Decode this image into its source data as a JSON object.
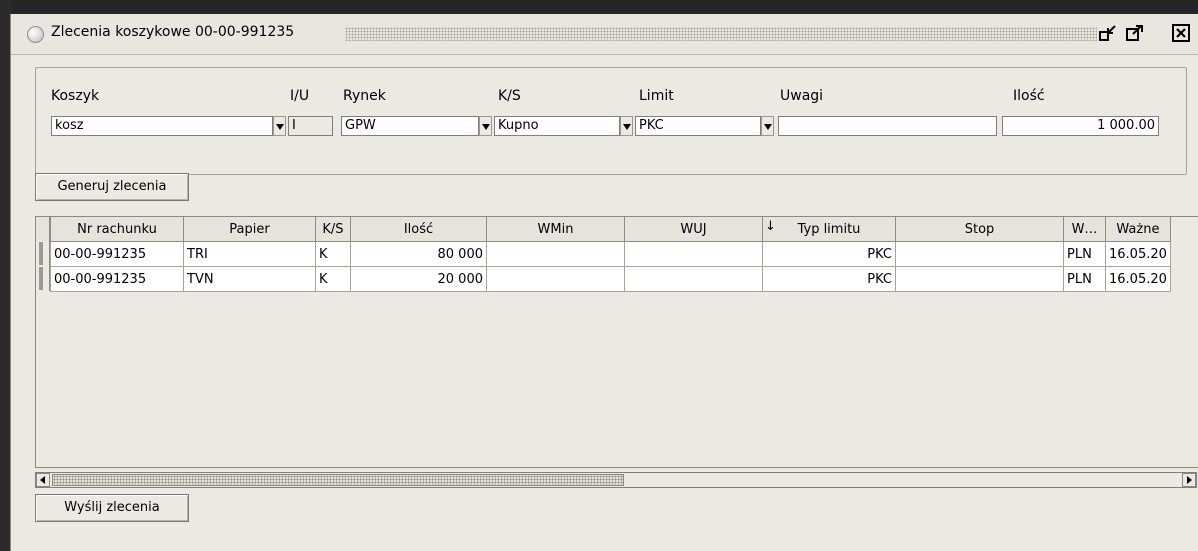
{
  "window": {
    "title": "Zlecenia koszykowe 00-00-991235"
  },
  "form": {
    "labels": {
      "koszyk": "Koszyk",
      "iu": "I/U",
      "rynek": "Rynek",
      "ks": "K/S",
      "limit": "Limit",
      "uwagi": "Uwagi",
      "ilosc": "Ilość"
    },
    "values": {
      "koszyk": "kosz",
      "iu": "I",
      "rynek": "GPW",
      "ks": "Kupno",
      "limit": "PKC",
      "uwagi": "",
      "ilosc": "1 000.00"
    }
  },
  "buttons": {
    "generate": "Generuj zlecenia",
    "send": "Wyślij zlecenia"
  },
  "table": {
    "sort_indicator": "↓",
    "columns": [
      "Nr rachunku",
      "Papier",
      "K/S",
      "Ilość",
      "WMin",
      "WUJ",
      "Typ limitu",
      "Stop",
      "W…",
      "Ważne"
    ],
    "rows": [
      {
        "account": "00-00-991235",
        "security": "TRI",
        "ks": "K",
        "qty": "80 000",
        "wmin": "",
        "wuj": "",
        "limit_type": "PKC",
        "stop": "",
        "currency": "PLN",
        "valid": "16.05.20"
      },
      {
        "account": "00-00-991235",
        "security": "TVN",
        "ks": "K",
        "qty": "20 000",
        "wmin": "",
        "wuj": "",
        "limit_type": "PKC",
        "stop": "",
        "currency": "PLN",
        "valid": "16.05.20"
      }
    ]
  },
  "icons": {
    "minimize": "minimize-icon",
    "maximize": "maximize-icon",
    "close": "close-icon"
  }
}
